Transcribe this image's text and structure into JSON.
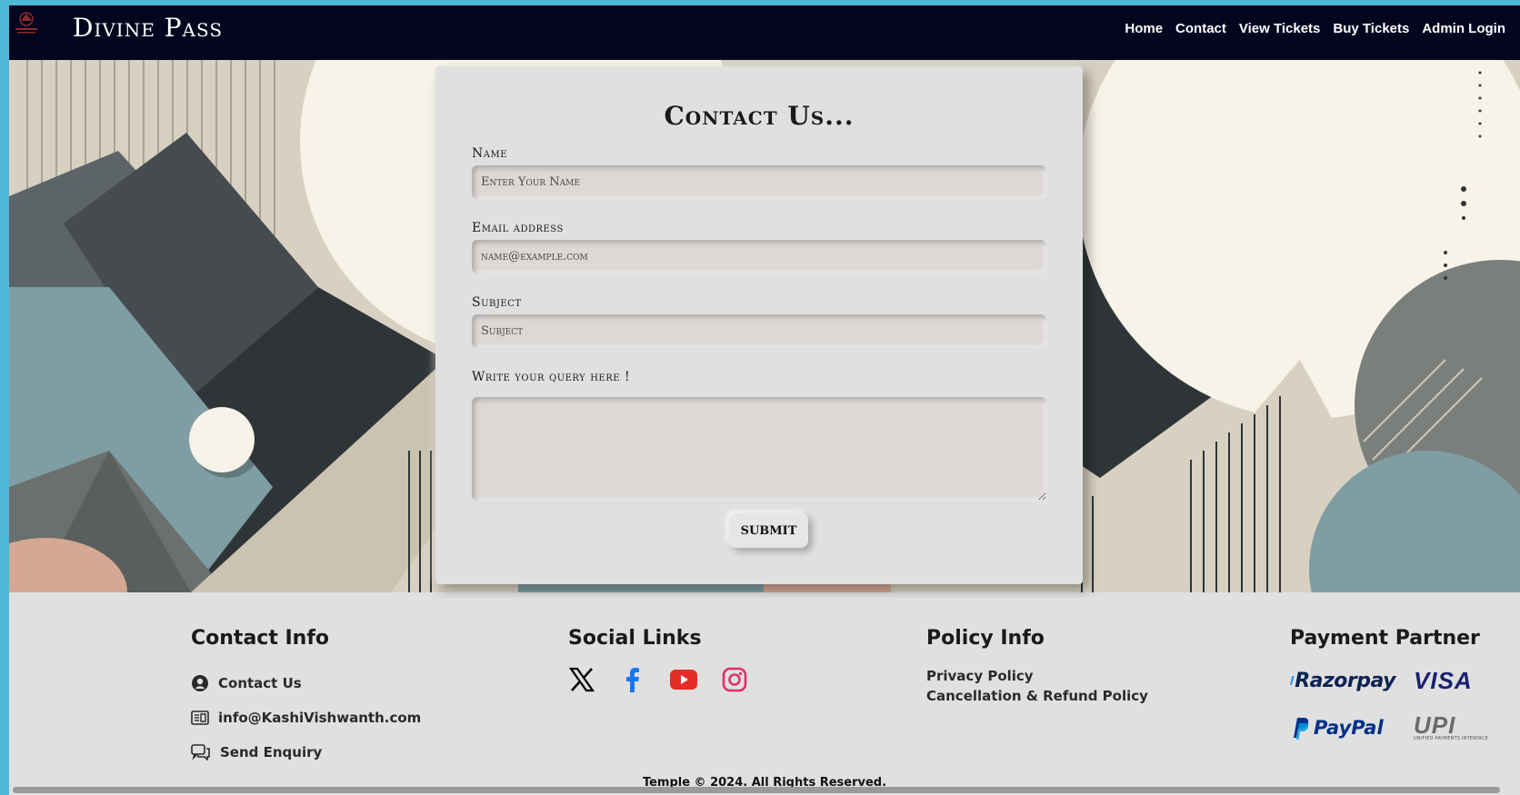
{
  "brand": {
    "name": "Divine Pass"
  },
  "nav": {
    "items": [
      "Home",
      "Contact",
      "View Tickets",
      "Buy Tickets",
      "Admin Login"
    ]
  },
  "form": {
    "title": "Contact Us...",
    "name_label": "Name",
    "name_placeholder": "Enter Your Name",
    "email_label": "Email address",
    "email_placeholder": "name@example.com",
    "subject_label": "Subject",
    "subject_placeholder": "Subject",
    "query_label": "Write your query here !",
    "query_value": "",
    "submit_label": "SUBMIT"
  },
  "footer": {
    "contact": {
      "heading": "Contact Info",
      "items": [
        {
          "label": "Contact Us",
          "icon": "user-circle-icon"
        },
        {
          "label": "info@KashiVishwanth.com",
          "icon": "id-card-icon"
        },
        {
          "label": "Send Enquiry",
          "icon": "chat-bubbles-icon"
        }
      ]
    },
    "social": {
      "heading": "Social Links",
      "items": [
        {
          "name": "x-icon",
          "color": "#000000"
        },
        {
          "name": "facebook-icon",
          "color": "#1877f2"
        },
        {
          "name": "youtube-icon",
          "color": "#e52d27"
        },
        {
          "name": "instagram-icon",
          "color": "#e1306c"
        }
      ]
    },
    "policy": {
      "heading": "Policy Info",
      "items": [
        "Privacy Policy",
        "Cancellation & Refund Policy"
      ]
    },
    "payment": {
      "heading": "Payment Partner",
      "partners": [
        "Razorpay",
        "VISA",
        "PayPal",
        "UPI"
      ],
      "upi_tagline": "UNIFIED PAYMENTS INTERFACE"
    },
    "copyright": "Temple © 2024. All Rights Reserved."
  },
  "colors": {
    "navbar_bg": "#03041e",
    "page_frame": "#4fb7d6",
    "razorpay_blue": "#0c2451",
    "visa_blue": "#1a1f71",
    "paypal_dark": "#003087",
    "paypal_light": "#009cde"
  }
}
